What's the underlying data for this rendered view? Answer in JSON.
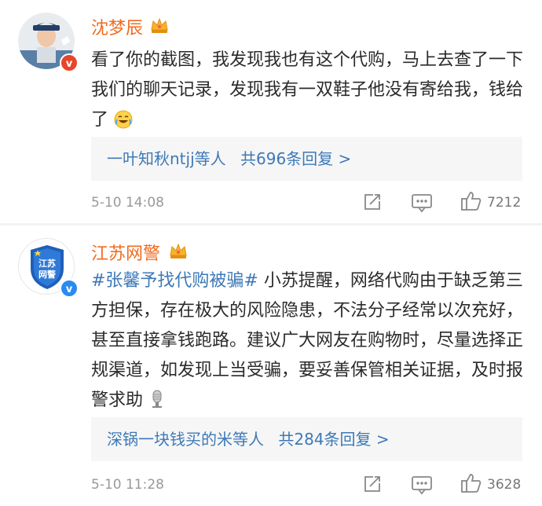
{
  "comments": [
    {
      "author": "沈梦辰",
      "text_plain": "看了你的截图，我发现我也有这个代购，马上去查了一下我们的聊天记录，发现我有一双鞋子他没有寄给我，钱给了",
      "replies_prefix": "一叶知秋ntjj等人",
      "replies_count": "共696条回复 >",
      "time": "5-10 14:08",
      "likes": "7212",
      "avatar_icon": "police-woman-avatar",
      "badge_color": "#e8452c"
    },
    {
      "author": "江苏网警",
      "avatar_text_1": "江苏",
      "avatar_text_2": "网警",
      "tag": "#张馨予找代购被骗#",
      "text_plain": " 小苏提醒，网络代购由于缺乏第三方担保，存在极大的风险隐患，不法分子经常以次充好，甚至直接拿钱跑路。建议广大网友在购物时，尽量选择正规渠道，如发现上当受骗，要妥善保管相关证据，及时报警求助",
      "replies_prefix": "深锅一块钱买的米等人",
      "replies_count": "共284条回复 >",
      "time": "5-10 11:28",
      "likes": "3628",
      "avatar_icon": "police-shield-avatar",
      "badge_color": "#2a8bf2"
    }
  ],
  "colors": {
    "name": "#f26b20",
    "link": "#3d79b7",
    "meta": "#999999"
  }
}
